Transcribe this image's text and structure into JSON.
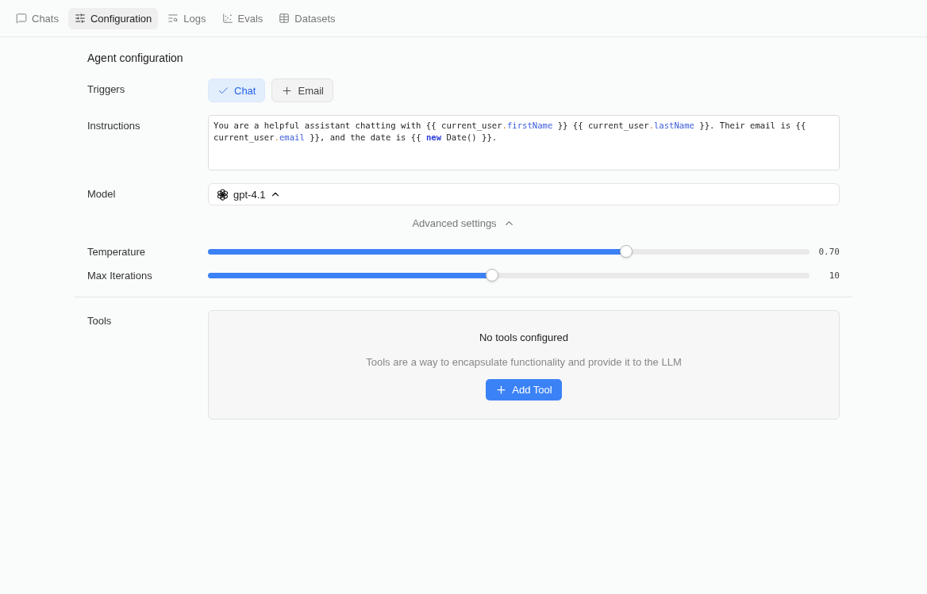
{
  "nav": {
    "tabs": [
      {
        "label": "Chats",
        "kind": "chat",
        "selected": false
      },
      {
        "label": "Configuration",
        "kind": "sliders",
        "selected": true
      },
      {
        "label": "Logs",
        "kind": "logs",
        "selected": false
      },
      {
        "label": "Evals",
        "kind": "chart",
        "selected": false
      },
      {
        "label": "Datasets",
        "kind": "table",
        "selected": false
      }
    ]
  },
  "title": "Agent configuration",
  "triggers": {
    "label": "Triggers",
    "items": [
      {
        "label": "Chat",
        "selected": true
      },
      {
        "label": "Email",
        "selected": false
      }
    ]
  },
  "instructions": {
    "label": "Instructions",
    "segments": [
      {
        "kind": "plain",
        "text": "You are a helpful assistant chatting with {{ current_user"
      },
      {
        "kind": "punct",
        "text": "."
      },
      {
        "kind": "prop",
        "text": "firstName"
      },
      {
        "kind": "plain",
        "text": " }} {{ current_user"
      },
      {
        "kind": "punct",
        "text": "."
      },
      {
        "kind": "prop",
        "text": "lastName"
      },
      {
        "kind": "plain",
        "text": " }}. Their email is {{ current_user"
      },
      {
        "kind": "punct",
        "text": "."
      },
      {
        "kind": "prop",
        "text": "email"
      },
      {
        "kind": "plain",
        "text": " }}, and the date is {{ "
      },
      {
        "kind": "keyword",
        "text": "new"
      },
      {
        "kind": "plain",
        "text": " Date() }}."
      }
    ]
  },
  "model": {
    "label": "Model",
    "value": "gpt-4.1"
  },
  "advanced": {
    "label": "Advanced settings",
    "expanded": true
  },
  "sliders": [
    {
      "label": "Temperature",
      "level": 0.695,
      "reading": "0.70"
    },
    {
      "label": "Max Iterations",
      "level": 0.472,
      "reading": "10"
    }
  ],
  "tools": {
    "label": "Tools",
    "empty_title": "No tools configured",
    "empty_text": "Tools are a way to encapsulate functionality and provide it to the LLM",
    "button": "Add Tool"
  }
}
